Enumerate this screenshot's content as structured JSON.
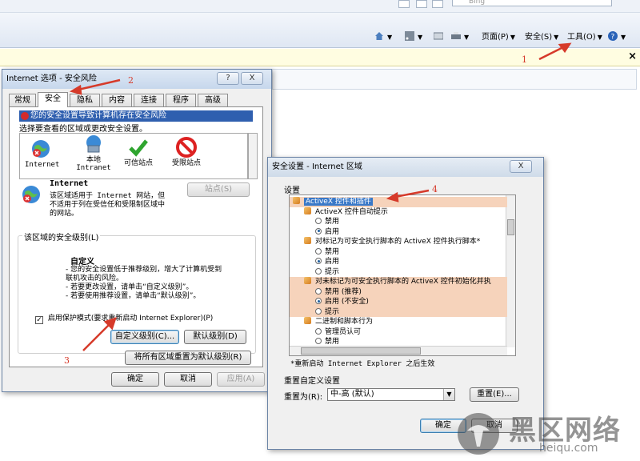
{
  "browser": {
    "search_placeholder": "Bing",
    "command_bar": {
      "page": "页面(P)",
      "safety": "安全(S)",
      "tools": "工具(O)"
    },
    "infobar_close": "×"
  },
  "ie_options": {
    "title": "Internet 选项 - 安全风险",
    "help_btn": "?",
    "close_btn": "X",
    "tabs": [
      "常规",
      "安全",
      "隐私",
      "内容",
      "连接",
      "程序",
      "高级"
    ],
    "active_tab": 1,
    "alert": "您的安全设置导致计算机存在安全风险",
    "instruction": "选择要查看的区域或更改安全设置。",
    "zones": [
      {
        "label1": "Internet",
        "label2": ""
      },
      {
        "label1": "本地",
        "label2": "Intranet"
      },
      {
        "label1": "可信站点",
        "label2": ""
      },
      {
        "label1": "受限站点",
        "label2": ""
      }
    ],
    "zone_name": "Internet",
    "zone_desc": "该区域适用于 Internet 网站，但不适用于列在受信任和受限制区域中的网站。",
    "sites_btn": "站点(S)",
    "level_group_label": "该区域的安全级别(L)",
    "custom_title": "自定义",
    "custom_lines": [
      "- 您的安全设置低于推荐级别，增大了计算机受到",
      "联机攻击的风险。",
      "- 若要更改设置，请单击“自定义级别”。",
      "- 若要使用推荐设置，请单击“默认级别”。"
    ],
    "protected_mode": "启用保护模式(要求重新启动 Internet Explorer)(P)",
    "custom_level_btn": "自定义级别(C)...",
    "default_level_btn": "默认级别(D)",
    "reset_all_btn": "将所有区域重置为默认级别(R)",
    "ok_btn": "确定",
    "cancel_btn": "取消",
    "apply_btn": "应用(A)"
  },
  "security_settings": {
    "title": "安全设置 - Internet 区域",
    "close_btn": "X",
    "settings_label": "设置",
    "tree": [
      {
        "type": "cat",
        "text": "ActiveX 控件和插件",
        "indent": 0,
        "hl": true
      },
      {
        "type": "item",
        "text": "ActiveX 控件自动提示",
        "indent": 1
      },
      {
        "type": "radio",
        "text": "禁用",
        "indent": 2,
        "checked": false
      },
      {
        "type": "radio",
        "text": "启用",
        "indent": 2,
        "checked": true
      },
      {
        "type": "item",
        "text": "对标记为可安全执行脚本的 ActiveX 控件执行脚本*",
        "indent": 1
      },
      {
        "type": "radio",
        "text": "禁用",
        "indent": 2,
        "checked": false
      },
      {
        "type": "radio",
        "text": "启用",
        "indent": 2,
        "checked": true
      },
      {
        "type": "radio",
        "text": "提示",
        "indent": 2,
        "checked": false
      },
      {
        "type": "item",
        "text": "对未标记为可安全执行脚本的 ActiveX 控件初始化并执",
        "indent": 1,
        "hl": true
      },
      {
        "type": "radio",
        "text": "禁用 (推荐)",
        "indent": 2,
        "checked": false,
        "hl": true
      },
      {
        "type": "radio",
        "text": "启用 (不安全)",
        "indent": 2,
        "checked": true,
        "hl": true
      },
      {
        "type": "radio",
        "text": "提示",
        "indent": 2,
        "checked": false,
        "hl": true
      },
      {
        "type": "item",
        "text": "二进制和脚本行为",
        "indent": 1
      },
      {
        "type": "radio",
        "text": "管理员认可",
        "indent": 2,
        "checked": false
      },
      {
        "type": "radio",
        "text": "禁用",
        "indent": 2,
        "checked": false
      }
    ],
    "restart_note": "*重新启动 Internet Explorer 之后生效",
    "reset_group_label": "重置自定义设置",
    "reset_to_label": "重置为(R):",
    "reset_value": "中-高 (默认)",
    "reset_btn": "重置(E)...",
    "ok_btn": "确定",
    "cancel_btn": "取消"
  },
  "annotations": [
    "1",
    "2",
    "3",
    "4"
  ],
  "watermark": {
    "text": "黑区网络",
    "url": "heiqu.com"
  },
  "colors": {
    "annotation": "#d63a2a",
    "alert_bar": "#2f5faf",
    "highlight": "#f6d3bb"
  }
}
